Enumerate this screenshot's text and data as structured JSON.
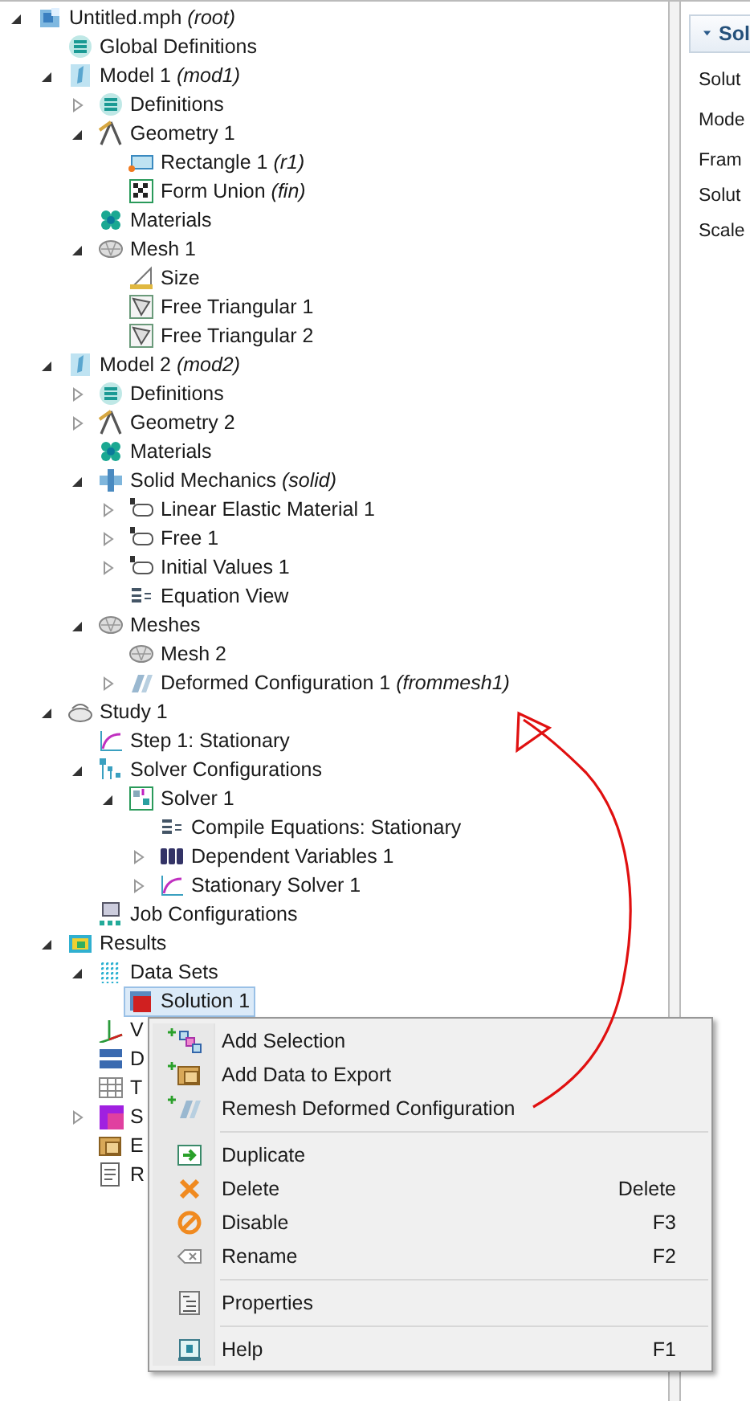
{
  "tree": [
    {
      "label": "Untitled.mph *(root)*",
      "kind": "file",
      "expanded": true,
      "selected": false,
      "children": [
        {
          "label": "Global Definitions",
          "kind": "definitions",
          "selected": false
        },
        {
          "label": "Model 1 *(mod1)*",
          "kind": "model",
          "expanded": true,
          "selected": false,
          "children": [
            {
              "label": "Definitions",
              "kind": "definitions",
              "expanded": false,
              "selected": false
            },
            {
              "label": "Geometry 1",
              "kind": "geometry",
              "expanded": true,
              "selected": false,
              "children": [
                {
                  "label": "Rectangle 1 *(r1)*",
                  "kind": "rectangle",
                  "selected": false
                },
                {
                  "label": "Form Union *(fin)*",
                  "kind": "checker",
                  "selected": false
                }
              ]
            },
            {
              "label": "Materials",
              "kind": "materials",
              "selected": false
            },
            {
              "label": "Mesh 1",
              "kind": "mesh",
              "expanded": true,
              "selected": false,
              "children": [
                {
                  "label": "Size",
                  "kind": "size",
                  "selected": false
                },
                {
                  "label": "Free Triangular 1",
                  "kind": "triangles",
                  "selected": false
                },
                {
                  "label": "Free Triangular 2",
                  "kind": "triangles",
                  "selected": false
                }
              ]
            }
          ]
        },
        {
          "label": "Model 2 *(mod2)*",
          "kind": "model",
          "expanded": true,
          "selected": false,
          "children": [
            {
              "label": "Definitions",
              "kind": "definitions",
              "expanded": false,
              "selected": false
            },
            {
              "label": "Geometry 2",
              "kind": "geometry",
              "expanded": false,
              "selected": false
            },
            {
              "label": "Materials",
              "kind": "materials",
              "selected": false
            },
            {
              "label": "Solid Mechanics *(solid)*",
              "kind": "physics",
              "expanded": true,
              "selected": false,
              "children": [
                {
                  "label": "Linear Elastic Material 1",
                  "kind": "domain",
                  "expanded": false,
                  "selected": false
                },
                {
                  "label": "Free 1",
                  "kind": "domain",
                  "expanded": false,
                  "selected": false
                },
                {
                  "label": "Initial Values 1",
                  "kind": "domain",
                  "expanded": false,
                  "selected": false
                },
                {
                  "label": "Equation View",
                  "kind": "equation",
                  "selected": false
                }
              ]
            },
            {
              "label": "Meshes",
              "kind": "mesh",
              "expanded": true,
              "selected": false,
              "children": [
                {
                  "label": "Mesh 2",
                  "kind": "mesh",
                  "selected": false
                },
                {
                  "label": "Deformed Configuration 1 *(frommesh1)*",
                  "kind": "deformed",
                  "expanded": false,
                  "selected": false
                }
              ]
            }
          ]
        },
        {
          "label": "Study 1",
          "kind": "study",
          "expanded": true,
          "selected": false,
          "children": [
            {
              "label": "Step 1: Stationary",
              "kind": "step",
              "selected": false
            },
            {
              "label": "Solver Configurations",
              "kind": "solvertree",
              "expanded": true,
              "selected": false,
              "children": [
                {
                  "label": "Solver 1",
                  "kind": "solver",
                  "expanded": true,
                  "selected": false,
                  "children": [
                    {
                      "label": "Compile Equations: Stationary",
                      "kind": "equation",
                      "selected": false
                    },
                    {
                      "label": "Dependent Variables 1",
                      "kind": "variables",
                      "expanded": false,
                      "selected": false
                    },
                    {
                      "label": "Stationary Solver 1",
                      "kind": "step",
                      "expanded": false,
                      "selected": false
                    }
                  ]
                }
              ]
            },
            {
              "label": "Job Configurations",
              "kind": "computer",
              "selected": false
            }
          ]
        },
        {
          "label": "Results",
          "kind": "results",
          "expanded": true,
          "selected": false,
          "children": [
            {
              "label": "Data Sets",
              "kind": "grid",
              "expanded": true,
              "selected": false,
              "children": [
                {
                  "label": "Solution 1",
                  "kind": "solution",
                  "selected": true
                }
              ]
            },
            {
              "label": "V",
              "kind": "axes",
              "selected": false
            },
            {
              "label": "D",
              "kind": "number",
              "selected": false
            },
            {
              "label": "T",
              "kind": "table",
              "selected": false
            },
            {
              "label": "S",
              "kind": "plot",
              "expanded": false,
              "selected": false
            },
            {
              "label": "E",
              "kind": "export",
              "selected": false
            },
            {
              "label": "R",
              "kind": "report",
              "selected": false
            }
          ]
        }
      ]
    }
  ],
  "settings": {
    "section_title": "Sol",
    "fields": [
      "Solut",
      "Mode",
      "Fram",
      "Solut",
      "Scale"
    ]
  },
  "context_menu": [
    [
      {
        "label": "Add Selection",
        "kind": "selection"
      },
      {
        "label": "Add Data to Export",
        "kind": "export"
      },
      {
        "label": "Remesh Deformed Configuration",
        "kind": "deformed"
      }
    ],
    [
      {
        "label": "Duplicate",
        "kind": "duplicate"
      },
      {
        "label": "Delete",
        "kind": "delete",
        "shortcut": "Delete"
      },
      {
        "label": "Disable",
        "kind": "disable",
        "shortcut": "F3"
      },
      {
        "label": "Rename",
        "kind": "rename",
        "shortcut": "F2"
      }
    ],
    [
      {
        "label": "Properties",
        "kind": "properties"
      }
    ],
    [
      {
        "label": "Help",
        "kind": "help",
        "shortcut": "F1"
      }
    ]
  ]
}
